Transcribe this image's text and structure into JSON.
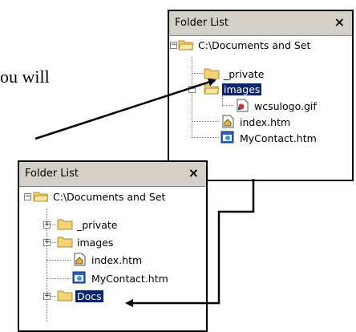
{
  "document_text": "ou will",
  "top_panel": {
    "title": "Folder List",
    "close_glyph": "×",
    "tree": [
      {
        "label": "C:\\Documents and Set",
        "icon": "folder-open-icon",
        "expander": "−"
      },
      {
        "label": "_private",
        "icon": "folder-icon"
      },
      {
        "label": "images",
        "icon": "folder-open-icon",
        "expander": "−",
        "selected": true
      },
      {
        "label": "wcsulogo.gif",
        "icon": "gif-image-icon"
      },
      {
        "label": "index.htm",
        "icon": "home-page-icon"
      },
      {
        "label": "MyContact.htm",
        "icon": "web-page-icon"
      }
    ]
  },
  "bottom_panel": {
    "title": "Folder List",
    "close_glyph": "×",
    "tree": [
      {
        "label": "C:\\Documents and Set",
        "icon": "folder-open-icon",
        "expander": "−"
      },
      {
        "label": "_private",
        "icon": "folder-icon",
        "expander": "+"
      },
      {
        "label": "images",
        "icon": "folder-icon",
        "expander": "+"
      },
      {
        "label": "index.htm",
        "icon": "home-page-icon"
      },
      {
        "label": "MyContact.htm",
        "icon": "web-page-icon"
      },
      {
        "label": "Docs",
        "icon": "folder-icon",
        "expander": "+",
        "selected": true
      }
    ]
  },
  "colors": {
    "selection": "#0a246a",
    "folder": "#f4d27a",
    "panel_header": "#d4d0c8"
  }
}
